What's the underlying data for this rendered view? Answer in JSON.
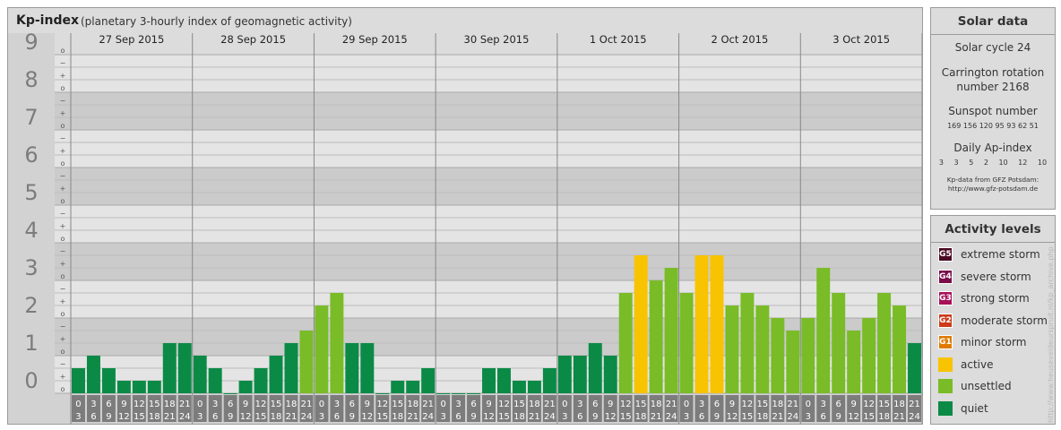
{
  "header": {
    "title": "Kp-index",
    "subtitle": "(planetary 3-hourly index of geomagnetic activity)"
  },
  "chart_data": {
    "type": "bar",
    "ylim": [
      0,
      9
    ],
    "y_ticks": [
      "0",
      "1",
      "2",
      "3",
      "4",
      "5",
      "6",
      "7",
      "8",
      "9"
    ],
    "minor_ticks": [
      "o",
      "+",
      "−"
    ],
    "days": [
      "27 Sep 2015",
      "28 Sep 2015",
      "29 Sep 2015",
      "30 Sep 2015",
      "1 Oct 2015",
      "2 Oct 2015",
      "3 Oct 2015"
    ],
    "interval_labels": [
      [
        "0",
        "3"
      ],
      [
        "3",
        "6"
      ],
      [
        "6",
        "9"
      ],
      [
        "9",
        "12"
      ],
      [
        "12",
        "15"
      ],
      [
        "15",
        "18"
      ],
      [
        "18",
        "21"
      ],
      [
        "21",
        "24"
      ]
    ],
    "values": [
      [
        0.667,
        1.0,
        0.667,
        0.333,
        0.333,
        0.333,
        1.333,
        1.333
      ],
      [
        1.0,
        0.667,
        0.0,
        0.333,
        0.667,
        1.0,
        1.333,
        1.667
      ],
      [
        2.333,
        2.667,
        1.333,
        1.333,
        0.0,
        0.333,
        0.333,
        0.667
      ],
      [
        0.0,
        0.0,
        0.0,
        0.667,
        0.667,
        0.333,
        0.333,
        0.667
      ],
      [
        1.0,
        1.0,
        1.333,
        1.0,
        2.667,
        3.667,
        3.0,
        3.333
      ],
      [
        2.667,
        3.667,
        3.667,
        2.333,
        2.667,
        2.333,
        2.0,
        1.667
      ],
      [
        2.0,
        3.333,
        2.667,
        1.667,
        2.0,
        2.667,
        2.333,
        1.333
      ]
    ],
    "colors": {
      "quiet": "#0b8a46",
      "unsettled": "#79bc27",
      "active": "#f8c300",
      "minor_storm": "#e07b00",
      "moderate_storm": "#cc3a1a",
      "strong_storm": "#a8115a",
      "severe_storm": "#7a0c4a",
      "extreme_storm": "#4a0a22"
    }
  },
  "solar": {
    "title": "Solar data",
    "cycle": "Solar cycle 24",
    "carrington_1": "Carrington rotation",
    "carrington_2": "number 2168",
    "sunspot_title": "Sunspot number",
    "sunspot_values": "169 156 120 95 93 62 51",
    "ap_title": "Daily Ap-index",
    "ap_values": "3 3 5 2 10 12 10",
    "source_1": "Kp-data from GFZ Potsdam:",
    "source_2": "http://www.gfz-potsdam.de"
  },
  "activity": {
    "title": "Activity levels",
    "levels": [
      {
        "badge": "G5",
        "label": "extreme storm",
        "color": "#4a0a22"
      },
      {
        "badge": "G4",
        "label": "severe storm",
        "color": "#7a0c4a"
      },
      {
        "badge": "G3",
        "label": "strong storm",
        "color": "#a8115a"
      },
      {
        "badge": "G2",
        "label": "moderate storm",
        "color": "#cc3a1a"
      },
      {
        "badge": "G1",
        "label": "minor storm",
        "color": "#e07b00"
      },
      {
        "badge": "",
        "label": "active",
        "color": "#f8c300"
      },
      {
        "badge": "",
        "label": "unsettled",
        "color": "#79bc27"
      },
      {
        "badge": "",
        "label": "quiet",
        "color": "#0b8a46"
      }
    ]
  },
  "watermark": "http://www.heuseveldeurspruit.nl/kp_archive.php"
}
